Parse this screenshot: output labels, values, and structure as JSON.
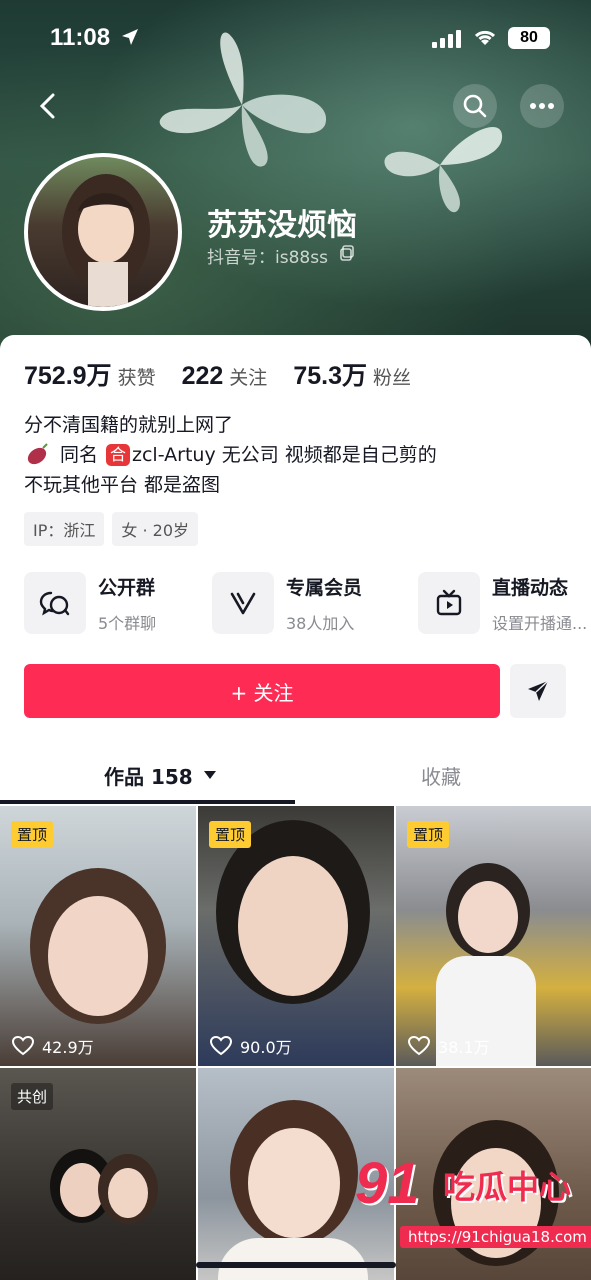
{
  "status_bar": {
    "time": "11:08",
    "battery": "80"
  },
  "profile": {
    "nickname": "苏苏没烦恼",
    "douyin_id": "抖音号：is88ss"
  },
  "stats": [
    {
      "num": "752.9万",
      "label": "获赞"
    },
    {
      "num": "222",
      "label": "关注"
    },
    {
      "num": "75.3万",
      "label": "粉丝"
    }
  ],
  "bio": {
    "line1": "分不清国籍的就别上网了",
    "line2_prefix": "同名",
    "line2_badge": "合",
    "line2_rest": "zcl-Artuy 无公司 视频都是自己剪的",
    "line3": "不玩其他平台 都是盗图"
  },
  "tags": [
    "IP：浙江",
    "女 · 20岁"
  ],
  "features": [
    {
      "title": "公开群",
      "sub": "5个群聊",
      "icon": "group-chat-icon"
    },
    {
      "title": "专属会员",
      "sub": "38人加入",
      "icon": "member-v-icon"
    },
    {
      "title": "直播动态",
      "sub": "设置开播通...",
      "icon": "live-tv-icon"
    }
  ],
  "actions": {
    "follow": "+ 关注"
  },
  "tabs": {
    "works": "作品 158",
    "favorites": "收藏"
  },
  "videos": [
    {
      "badge": "置顶",
      "likes": "42.9万"
    },
    {
      "badge": "置顶",
      "likes": "90.0万"
    },
    {
      "badge": "置顶",
      "likes": "38.1万"
    },
    {
      "badge": "共创",
      "likes": ""
    },
    {
      "badge": "",
      "likes": ""
    },
    {
      "badge": "",
      "likes": ""
    }
  ],
  "watermark": {
    "logo": "91",
    "name": "吃瓜中心",
    "url": "https://91chigua18.com"
  },
  "colors": {
    "accent": "#fe2c55",
    "pin_badge": "#fecc30"
  }
}
